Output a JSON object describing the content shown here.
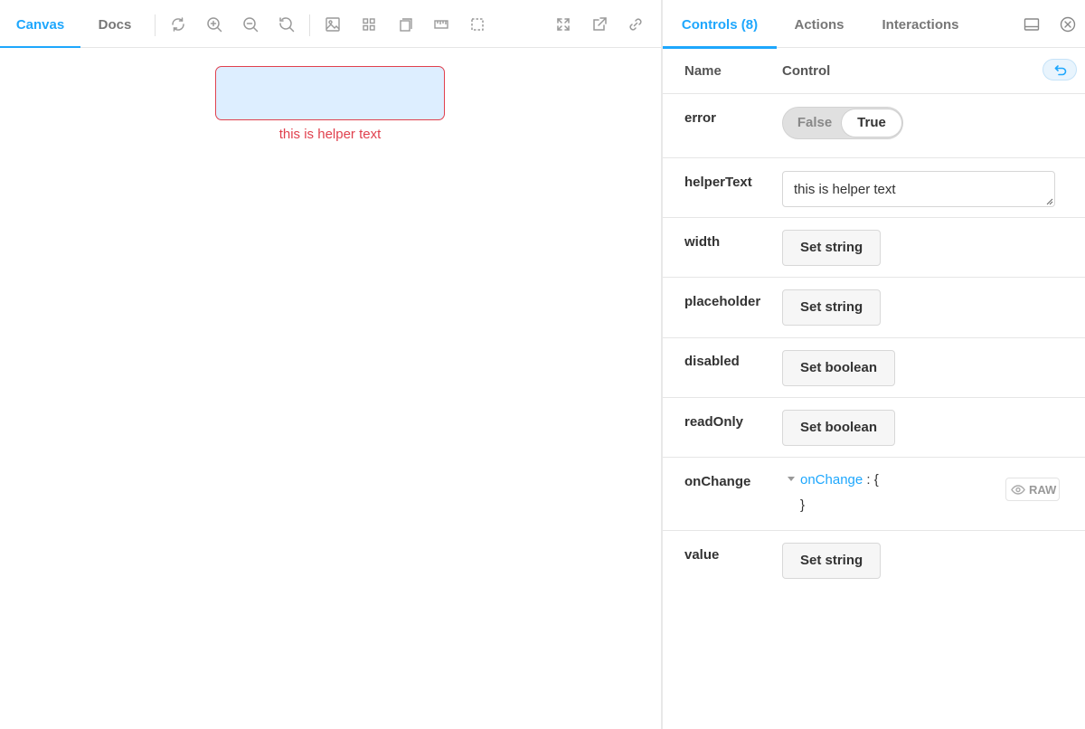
{
  "toolbar": {
    "tabs": [
      {
        "label": "Canvas",
        "active": true
      },
      {
        "label": "Docs",
        "active": false
      }
    ],
    "tool_icons": [
      "refresh-icon",
      "zoom-in-icon",
      "zoom-out-icon",
      "zoom-reset-icon",
      "background-icon",
      "grid-icon",
      "viewport-icon",
      "measure-icon",
      "outline-icon",
      "fullscreen-icon",
      "open-new-tab-icon",
      "copy-link-icon"
    ]
  },
  "canvas": {
    "helper_text": "this is helper text",
    "input_background": "#ddeeff",
    "error_color": "#e0414e"
  },
  "addons": {
    "tabs": [
      {
        "label": "Controls (8)",
        "active": true
      },
      {
        "label": "Actions",
        "active": false
      },
      {
        "label": "Interactions",
        "active": false
      }
    ],
    "accent_color": "#1ea7fd"
  },
  "controls": {
    "header": {
      "name": "Name",
      "control": "Control"
    },
    "rows": [
      {
        "name": "error",
        "type": "boolean-toggle",
        "false_label": "False",
        "true_label": "True",
        "value": true
      },
      {
        "name": "helperText",
        "type": "text",
        "value": "this is helper text"
      },
      {
        "name": "width",
        "type": "button",
        "button_label": "Set string"
      },
      {
        "name": "placeholder",
        "type": "button",
        "button_label": "Set string"
      },
      {
        "name": "disabled",
        "type": "button",
        "button_label": "Set boolean"
      },
      {
        "name": "readOnly",
        "type": "button",
        "button_label": "Set boolean"
      },
      {
        "name": "onChange",
        "type": "object",
        "key": "onChange",
        "separator": ": {",
        "close": "}",
        "raw_label": "RAW"
      },
      {
        "name": "value",
        "type": "button",
        "button_label": "Set string"
      }
    ]
  }
}
